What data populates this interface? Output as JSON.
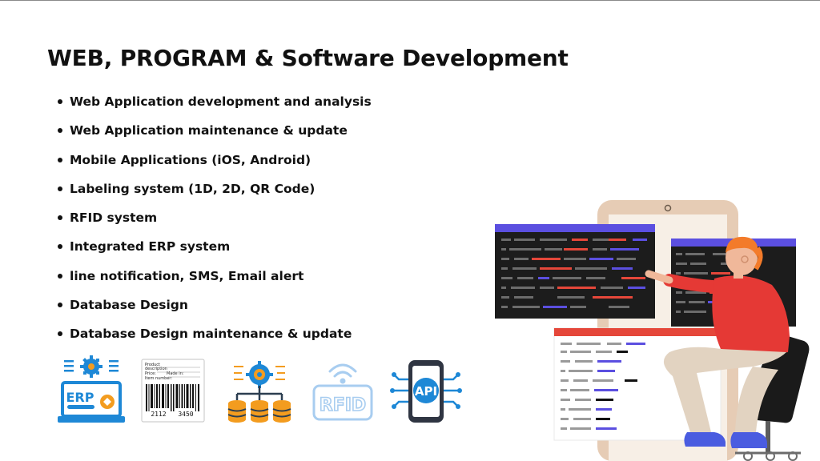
{
  "title": "WEB, PROGRAM & Software Development",
  "services": [
    "Web Application development and analysis",
    "Web Application maintenance & update",
    "Mobile Applications (iOS, Android)",
    "Labeling system (1D, 2D, QR Code)",
    "RFID system",
    "Integrated ERP system",
    "line notification, SMS, Email alert",
    "Database Design",
    "Database Design maintenance & update"
  ],
  "icons": {
    "erp": {
      "text": "ERP",
      "icon": "erp-laptop-gear-icon"
    },
    "barcode": {
      "product_label": "Product",
      "description_label": "description",
      "price_label": "Price:",
      "made_in_label": "Made in:",
      "item_number_label": "Item number:",
      "code_left": "2112",
      "code_right": "3450",
      "icon": "barcode-label-icon"
    },
    "database": {
      "icon": "database-network-gear-icon"
    },
    "rfid": {
      "text": "RFID",
      "icon": "rfid-wireless-icon"
    },
    "api": {
      "text": "API",
      "icon": "api-phone-circuit-icon"
    }
  },
  "colors": {
    "accent_blue": "#1e88d6",
    "accent_orange": "#f39c1f",
    "code_purple": "#5b4fe0",
    "code_red": "#e5473a",
    "shirt_red": "#e53935",
    "shoe_blue": "#4a5ce0",
    "pants_beige": "#e2d3c1",
    "phone_frame": "#e6ccb5"
  }
}
